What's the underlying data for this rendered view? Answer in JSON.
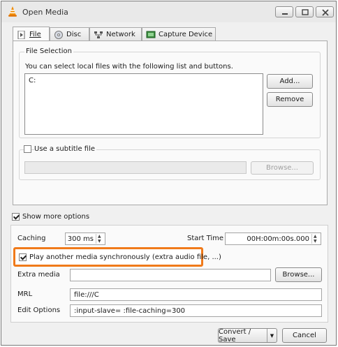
{
  "window": {
    "title": "Open Media",
    "controls": {
      "minimize": "—",
      "maximize": "◻",
      "close": "✕"
    }
  },
  "tabs": [
    {
      "label": "File",
      "icon": "file-icon",
      "active": true
    },
    {
      "label": "Disc",
      "icon": "disc-icon",
      "active": false
    },
    {
      "label": "Network",
      "icon": "network-icon",
      "active": false
    },
    {
      "label": "Capture Device",
      "icon": "capture-device-icon",
      "active": false
    }
  ],
  "file_tab": {
    "group_title": "File Selection",
    "instructions": "You can select local files with the following list and buttons.",
    "files": [
      "C:"
    ],
    "add_label": "Add...",
    "remove_label": "Remove",
    "subtitle": {
      "checkbox_label": "Use a subtitle file",
      "checked": false,
      "value": "",
      "browse_label": "Browse..."
    }
  },
  "more_options": {
    "checkbox_label": "Show more options",
    "checked": true,
    "caching_label": "Caching",
    "caching_value": "300 ms",
    "start_time_label": "Start Time",
    "start_time_value": "00H:00m:00s.000",
    "sync_label": "Play another media synchronously (extra audio file, ...)",
    "sync_checked": true,
    "extra_media_label": "Extra media",
    "extra_media_value": "",
    "extra_browse_label": "Browse...",
    "mrl_label": "MRL",
    "mrl_value": "file:///C",
    "edit_options_label": "Edit Options",
    "edit_options_value": ":input-slave= :file-caching=300"
  },
  "footer": {
    "convert_label": "Convert / Save",
    "cancel_label": "Cancel"
  },
  "colors": {
    "highlight": "#f07a1a",
    "vlc_orange": "#f08c00"
  }
}
